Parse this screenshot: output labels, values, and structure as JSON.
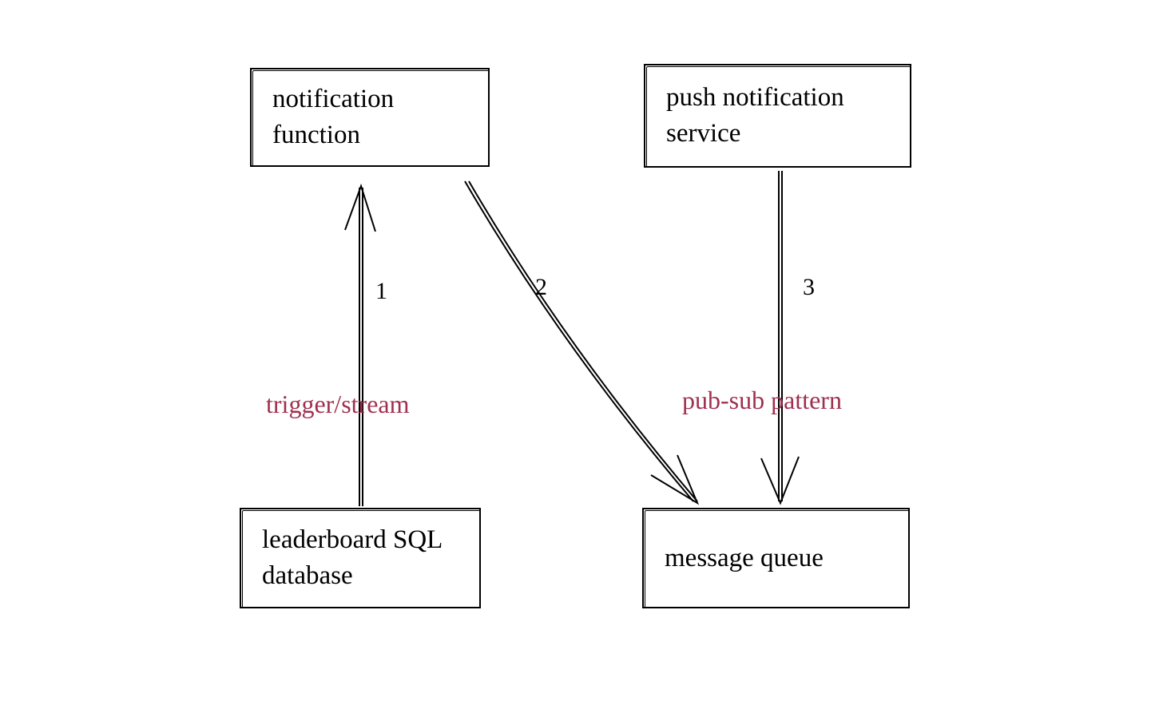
{
  "diagram": {
    "nodes": {
      "notification_function": "notification function",
      "push_notification_service": "push notification service",
      "leaderboard_db": "leaderboard SQL database",
      "message_queue": "message queue"
    },
    "edges": {
      "edge1_label": "1",
      "edge2_label": "2",
      "edge3_label": "3"
    },
    "annotations": {
      "trigger_stream": "trigger/stream",
      "pub_sub": "pub-sub pattern"
    }
  },
  "chart_data": {
    "type": "diagram",
    "nodes": [
      {
        "id": "notification_function",
        "label": "notification function"
      },
      {
        "id": "push_notification_service",
        "label": "push notification service"
      },
      {
        "id": "leaderboard_db",
        "label": "leaderboard SQL database"
      },
      {
        "id": "message_queue",
        "label": "message queue"
      }
    ],
    "edges": [
      {
        "id": "1",
        "from": "leaderboard_db",
        "to": "notification_function",
        "annotation": "trigger/stream"
      },
      {
        "id": "2",
        "from": "notification_function",
        "to": "message_queue"
      },
      {
        "id": "3",
        "from": "push_notification_service",
        "to": "message_queue",
        "annotation": "pub-sub pattern"
      }
    ]
  }
}
